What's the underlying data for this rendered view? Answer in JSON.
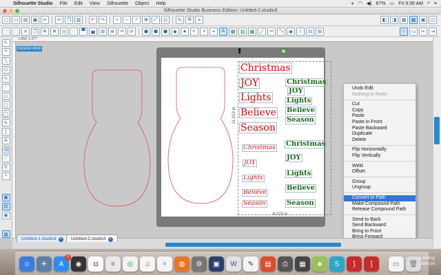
{
  "menubar": {
    "app": "Silhouette Studio",
    "items": [
      "File",
      "Edit",
      "View",
      "Silhouette",
      "Object",
      "Help"
    ],
    "battery": "67%",
    "clock": "Fri 9:39 AM"
  },
  "window": {
    "title": "Silhouette Studio Business Edition: Untitled-2.studio3"
  },
  "canvas": {
    "design_tag": "DESIGN VIEW",
    "coords": "1.858, 1.377",
    "dim_vertical": "11.013 in",
    "dim_horizontal": "6.223 in"
  },
  "words_red_large": [
    "Christmas",
    "JOY",
    "Lights",
    "Believe",
    "Season"
  ],
  "words_red_script": [
    "Christmas",
    "JOY",
    "Lights",
    "Believe",
    "Season"
  ],
  "words_green_top": [
    "Christmas",
    "JOY",
    "Lights",
    "Believe",
    "Season"
  ],
  "words_green_bottom": [
    "Christmas",
    "JOY",
    "Lights",
    "Believe",
    "Season"
  ],
  "context_menu": {
    "undo": "Undo Edit",
    "redo": "Nothing to Redo",
    "cut": "Cut",
    "copy": "Copy",
    "paste": "Paste",
    "paste_front": "Paste in Front",
    "paste_back": "Paste Backward",
    "duplicate": "Duplicate",
    "delete": "Delete",
    "flip_h": "Flip Horizontally",
    "flip_v": "Flip Vertically",
    "weld": "Weld",
    "offset": "Offset",
    "group": "Group",
    "ungroup": "Ungroup",
    "convert_path": "Convert to Path",
    "make_compound": "Make Compound Path",
    "release_compound": "Release Compound Path",
    "send_back": "Send to Back",
    "send_backward": "Send Backward",
    "bring_front": "Bring to Front",
    "bring_forward": "Bring Forward"
  },
  "tabs": [
    "Untitled-1.studio3",
    "Untitled-2.studio3"
  ],
  "dock": {
    "badge_appstore": "3",
    "calendar_day": "11",
    "desktop_text": "e editing\ndate.pd"
  }
}
